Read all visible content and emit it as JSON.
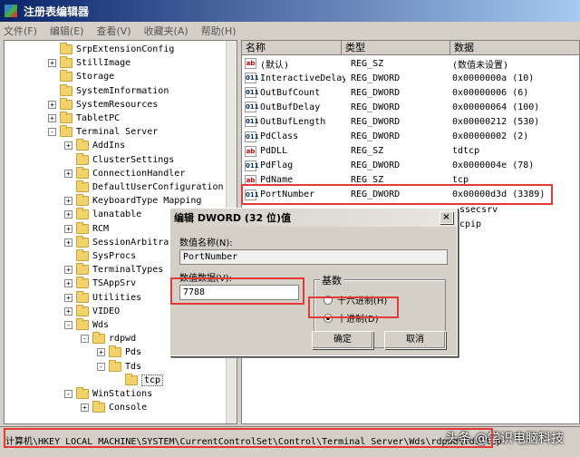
{
  "window": {
    "title": "注册表编辑器"
  },
  "menu": [
    "文件(F)",
    "编辑(E)",
    "查看(V)",
    "收藏夹(A)",
    "帮助(H)"
  ],
  "tree": [
    {
      "label": "SrpExtensionConfig",
      "level": 0,
      "pm": ""
    },
    {
      "label": "StillImage",
      "level": 0,
      "pm": "+"
    },
    {
      "label": "Storage",
      "level": 0,
      "pm": ""
    },
    {
      "label": "SystemInformation",
      "level": 0,
      "pm": ""
    },
    {
      "label": "SystemResources",
      "level": 0,
      "pm": "+"
    },
    {
      "label": "TabletPC",
      "level": 0,
      "pm": "+"
    },
    {
      "label": "Terminal Server",
      "level": 0,
      "pm": "-"
    },
    {
      "label": "AddIns",
      "level": 1,
      "pm": "+"
    },
    {
      "label": "ClusterSettings",
      "level": 1,
      "pm": ""
    },
    {
      "label": "ConnectionHandler",
      "level": 1,
      "pm": "+"
    },
    {
      "label": "DefaultUserConfiguration",
      "level": 1,
      "pm": ""
    },
    {
      "label": "KeyboardType Mapping",
      "level": 1,
      "pm": "+"
    },
    {
      "label": "lanatable",
      "level": 1,
      "pm": "+"
    },
    {
      "label": "RCM",
      "level": 1,
      "pm": "+"
    },
    {
      "label": "SessionArbitrat",
      "level": 1,
      "pm": "+"
    },
    {
      "label": "SysProcs",
      "level": 1,
      "pm": ""
    },
    {
      "label": "TerminalTypes",
      "level": 1,
      "pm": "+"
    },
    {
      "label": "TSAppSrv",
      "level": 1,
      "pm": "+"
    },
    {
      "label": "Utilities",
      "level": 1,
      "pm": "+"
    },
    {
      "label": "VIDEO",
      "level": 1,
      "pm": "+"
    },
    {
      "label": "Wds",
      "level": 1,
      "pm": "-"
    },
    {
      "label": "rdpwd",
      "level": 2,
      "pm": "-"
    },
    {
      "label": "Pds",
      "level": 3,
      "pm": "+"
    },
    {
      "label": "Tds",
      "level": 3,
      "pm": "-"
    },
    {
      "label": "tcp",
      "level": 4,
      "pm": ""
    },
    {
      "label": "WinStations",
      "level": 1,
      "pm": "-"
    },
    {
      "label": "Console",
      "level": 2,
      "pm": "+"
    }
  ],
  "list": {
    "headers": [
      "名称",
      "类型",
      "数据"
    ],
    "rows": [
      {
        "icon": "ab",
        "kind": "sz",
        "name": "(默认)",
        "type": "REG_SZ",
        "data": "(数值未设置)"
      },
      {
        "icon": "011",
        "kind": "dw",
        "name": "InteractiveDelay",
        "type": "REG_DWORD",
        "data": "0x0000000a (10)"
      },
      {
        "icon": "011",
        "kind": "dw",
        "name": "OutBufCount",
        "type": "REG_DWORD",
        "data": "0x00000006 (6)"
      },
      {
        "icon": "011",
        "kind": "dw",
        "name": "OutBufDelay",
        "type": "REG_DWORD",
        "data": "0x00000064 (100)"
      },
      {
        "icon": "011",
        "kind": "dw",
        "name": "OutBufLength",
        "type": "REG_DWORD",
        "data": "0x00000212 (530)"
      },
      {
        "icon": "011",
        "kind": "dw",
        "name": "PdClass",
        "type": "REG_DWORD",
        "data": "0x00000002 (2)"
      },
      {
        "icon": "ab",
        "kind": "sz",
        "name": "PdDLL",
        "type": "REG_SZ",
        "data": "tdtcp"
      },
      {
        "icon": "011",
        "kind": "dw",
        "name": "PdFlag",
        "type": "REG_DWORD",
        "data": "0x0000004e (78)"
      },
      {
        "icon": "ab",
        "kind": "sz",
        "name": "PdName",
        "type": "REG_SZ",
        "data": "tcp"
      },
      {
        "icon": "011",
        "kind": "dw",
        "name": "PortNumber",
        "type": "REG_DWORD",
        "data": "0x00000d3d (3389)"
      },
      {
        "icon": "",
        "kind": "",
        "name": "",
        "type": "",
        "data": "ssecsrv"
      },
      {
        "icon": "",
        "kind": "",
        "name": "",
        "type": "",
        "data": "cpip"
      }
    ]
  },
  "dialog": {
    "title": "编辑 DWORD (32 位)值",
    "close": "×",
    "name_label": "数值名称(N):",
    "name_value": "PortNumber",
    "data_label": "数值数据(V):",
    "data_value": "7788",
    "base_label": "基数",
    "hex_label": "十六进制(H)",
    "dec_label": "十进制(D)",
    "selected_base": "dec",
    "ok": "确定",
    "cancel": "取消"
  },
  "status": {
    "path": "计算机\\HKEY_LOCAL_MACHINE\\SYSTEM\\CurrentControlSet\\Control\\Terminal Server\\Wds\\rdpwd\\Tds\\tcp",
    "watermark": "头条 @学识电脑科技"
  }
}
